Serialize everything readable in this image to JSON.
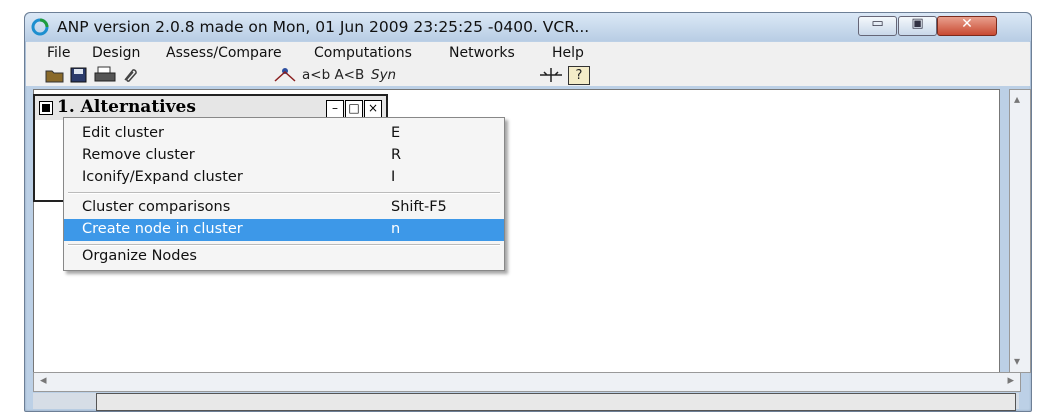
{
  "window": {
    "title": "ANP version 2.0.8 made on Mon, 01 Jun 2009 23:25:25 -0400.  VCR...",
    "controls": {
      "minimize": "▭",
      "maximize": "▣",
      "close": "✕"
    }
  },
  "menubar": {
    "items": [
      "File",
      "Design",
      "Assess/Compare",
      "Computations",
      "Networks",
      "Help"
    ]
  },
  "toolbar": {
    "compare_label": "a<b A<B",
    "syn_label": "Syn",
    "help_icon_text": "?"
  },
  "cluster": {
    "title": "1. Alternatives",
    "minimize": "–",
    "restore": "□",
    "close": "×"
  },
  "context_menu": {
    "items": [
      {
        "label": "Edit cluster",
        "key": "E"
      },
      {
        "label": "Remove cluster",
        "key": "R"
      },
      {
        "label": "Iconify/Expand cluster",
        "key": "I"
      },
      {
        "label": "Cluster comparisons",
        "key": "Shift-F5"
      },
      {
        "label": "Create node in cluster",
        "key": "n"
      },
      {
        "label": "Organize Nodes",
        "key": ""
      }
    ],
    "selected_index": 4
  },
  "scroll": {
    "left_arrow": "◂",
    "right_arrow": "▸",
    "up_arrow": "▴",
    "down_arrow": "▾"
  },
  "colors": {
    "selection": "#3d98e8",
    "close_button": "#c84a32"
  }
}
